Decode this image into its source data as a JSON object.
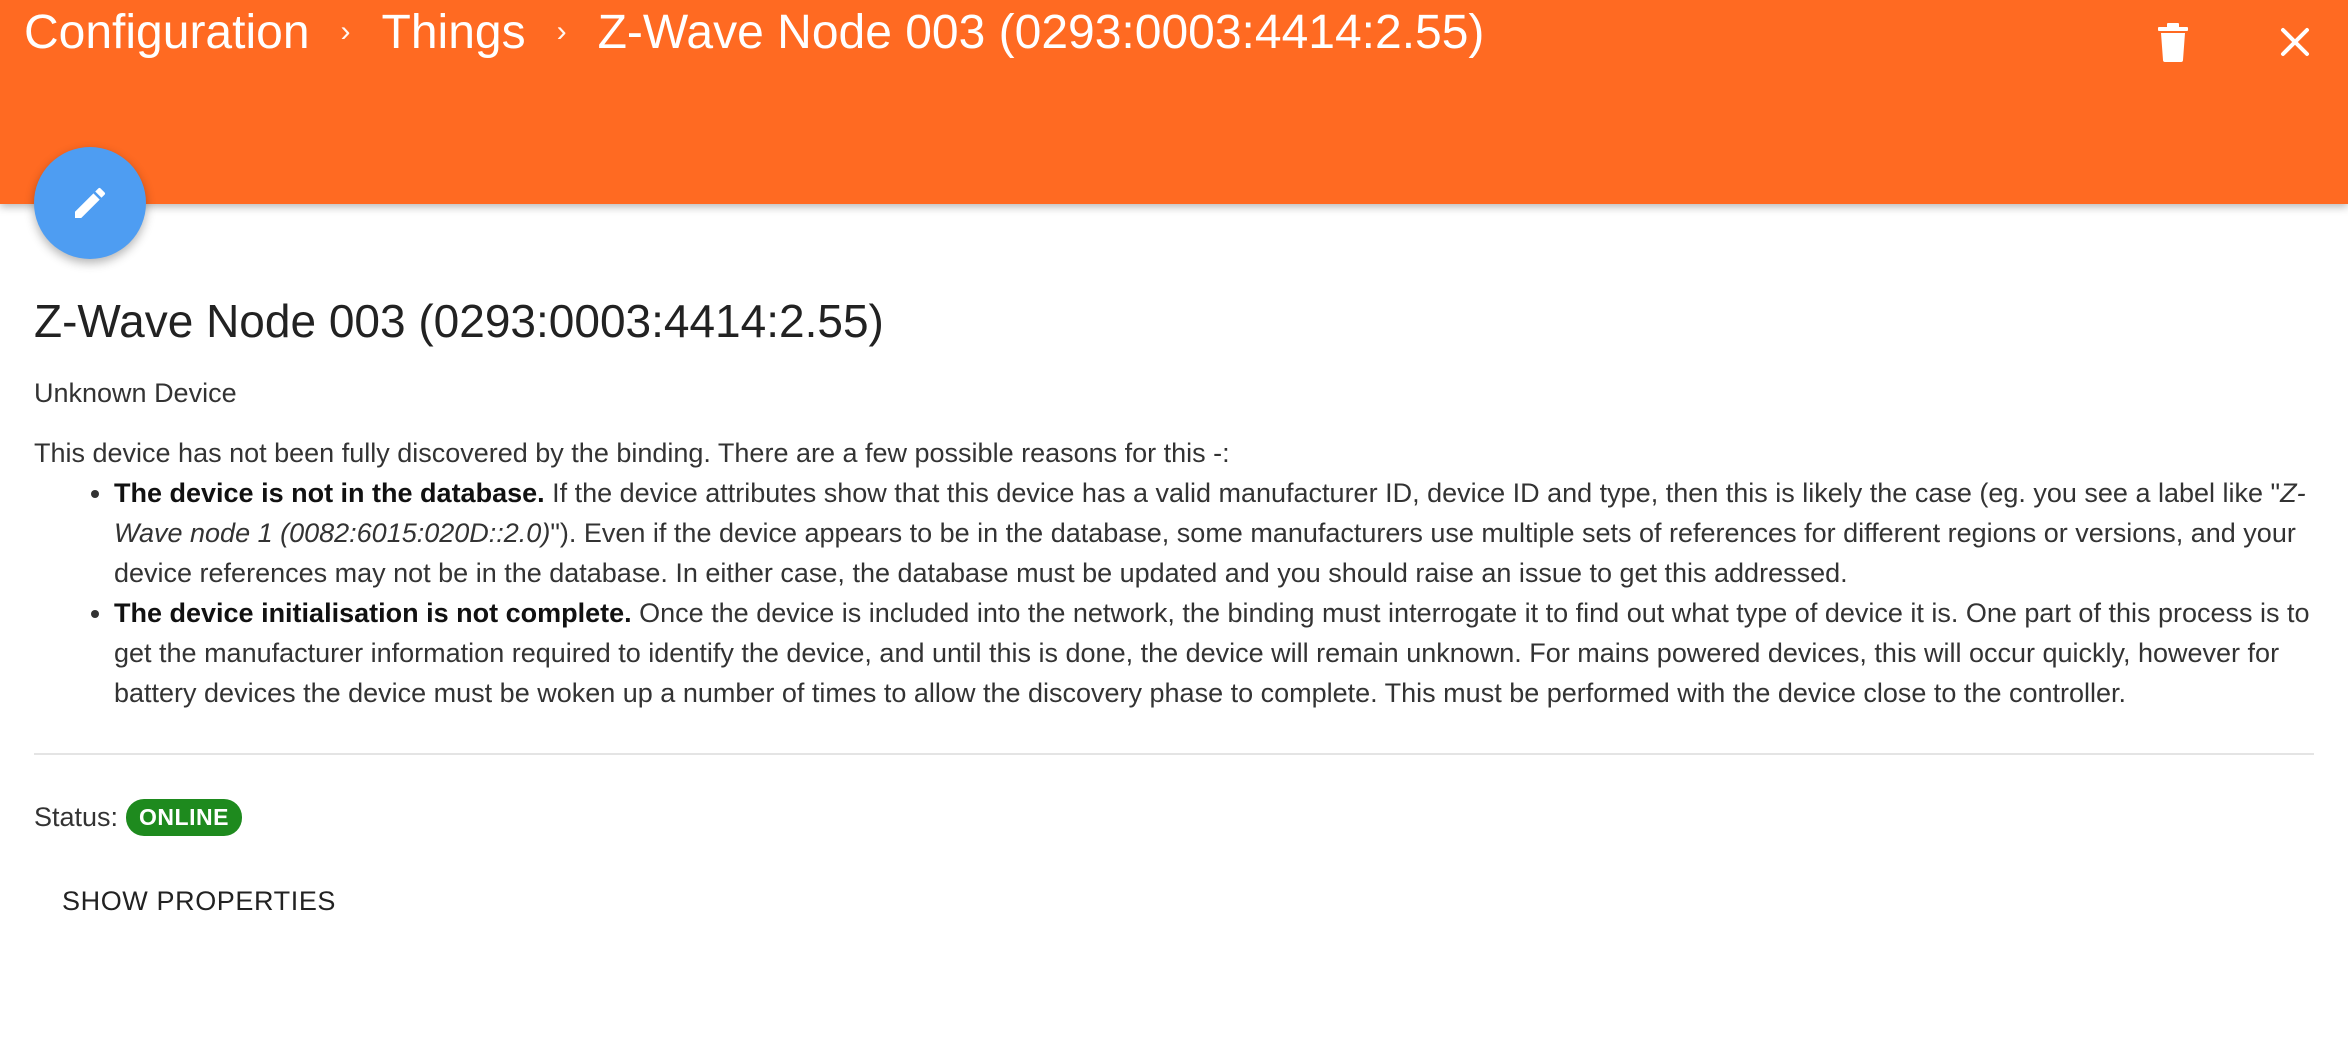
{
  "header": {
    "breadcrumbs": [
      "Configuration",
      "Things",
      "Z-Wave Node 003 (0293:0003:4414:2.55)"
    ],
    "separator": "›",
    "accent_color": "#ff6a22",
    "delete_icon": "trash-icon",
    "close_icon": "close-icon"
  },
  "fab": {
    "icon": "pencil-icon",
    "color": "#4e9df2"
  },
  "device": {
    "title": "Z-Wave Node 003 (0293:0003:4414:2.55)",
    "subtitle": "Unknown Device",
    "intro": "This device has not been fully discovered by the binding. There are a few possible reasons for this -:",
    "reasons": [
      {
        "heading": "The device is not in the database.",
        "text_before": " If the device attributes show that this device has a valid manufacturer ID, device ID and type, then this is likely the case (eg. you see a label like \"",
        "example": "Z-Wave node 1 (0082:6015:020D::2.0)",
        "text_after": "\"). Even if the device appears to be in the database, some manufacturers use multiple sets of references for different regions or versions, and your device references may not be in the database. In either case, the database must be updated and you should raise an issue to get this addressed."
      },
      {
        "heading": "The device initialisation is not complete.",
        "text": " Once the device is included into the network, the binding must interrogate it to find out what type of device it is. One part of this process is to get the manufacturer information required to identify the device, and until this is done, the device will remain unknown. For mains powered devices, this will occur quickly, however for battery devices the device must be woken up a number of times to allow the discovery phase to complete. This must be performed with the device close to the controller."
      }
    ]
  },
  "status": {
    "label": "Status:",
    "value": "ONLINE",
    "color": "#1e8a1e"
  },
  "actions": {
    "show_properties": "SHOW PROPERTIES"
  }
}
